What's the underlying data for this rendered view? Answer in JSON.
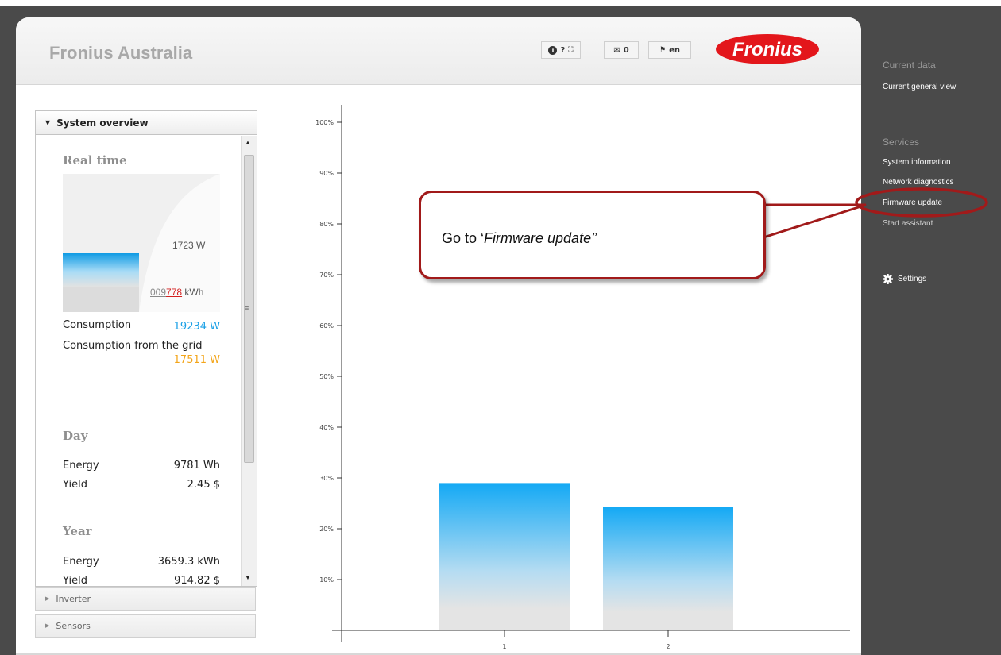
{
  "header": {
    "title": "Fronius Australia",
    "toolbar": {
      "info": "i",
      "help": "?",
      "fullscreen": "⛶",
      "messages_count": "0",
      "language": "en"
    },
    "logo_text": "Fronius"
  },
  "system_panel": {
    "title": "System overview",
    "realtime": {
      "heading": "Real time",
      "power": "1723 W",
      "counter_prefix": "009",
      "counter_red": "778",
      "counter_unit": "kWh",
      "consumption_label": "Consumption",
      "consumption_value": "19234  W",
      "grid_label": "Consumption from the grid",
      "grid_value": "17511  W"
    },
    "day": {
      "heading": "Day",
      "energy_label": "Energy",
      "energy_value": "9781 Wh",
      "yield_label": "Yield",
      "yield_value": "2.45 $"
    },
    "year": {
      "heading": "Year",
      "energy_label": "Energy",
      "energy_value": "3659.3 kWh",
      "yield_label": "Yield",
      "yield_value": "914.82 $"
    }
  },
  "accordion": {
    "inverter": "Inverter",
    "sensors": "Sensors"
  },
  "sidebar": {
    "current_data_heading": "Current data",
    "current_general_view": "Current general view",
    "services_heading": "Services",
    "services": [
      "System information",
      "Network diagnostics",
      "Firmware update",
      "Start assistant"
    ],
    "settings": "Settings"
  },
  "callout": {
    "prefix": "Go to ‘",
    "emphasis": "Firmware update’’"
  },
  "chart_data": {
    "type": "bar",
    "categories": [
      "1",
      "2"
    ],
    "values": [
      29,
      24.3
    ],
    "yticks": [
      "10%",
      "20%",
      "30%",
      "40%",
      "50%",
      "60%",
      "70%",
      "80%",
      "90%",
      "100%"
    ],
    "ylim": [
      0,
      100
    ],
    "bar_color_top": "#14a9f4",
    "bar_color_bottom": "#e4e4e4"
  },
  "colors": {
    "highlight": "#a11a1a",
    "accent_blue": "#1aa0e6",
    "accent_orange": "#f3a51a"
  }
}
